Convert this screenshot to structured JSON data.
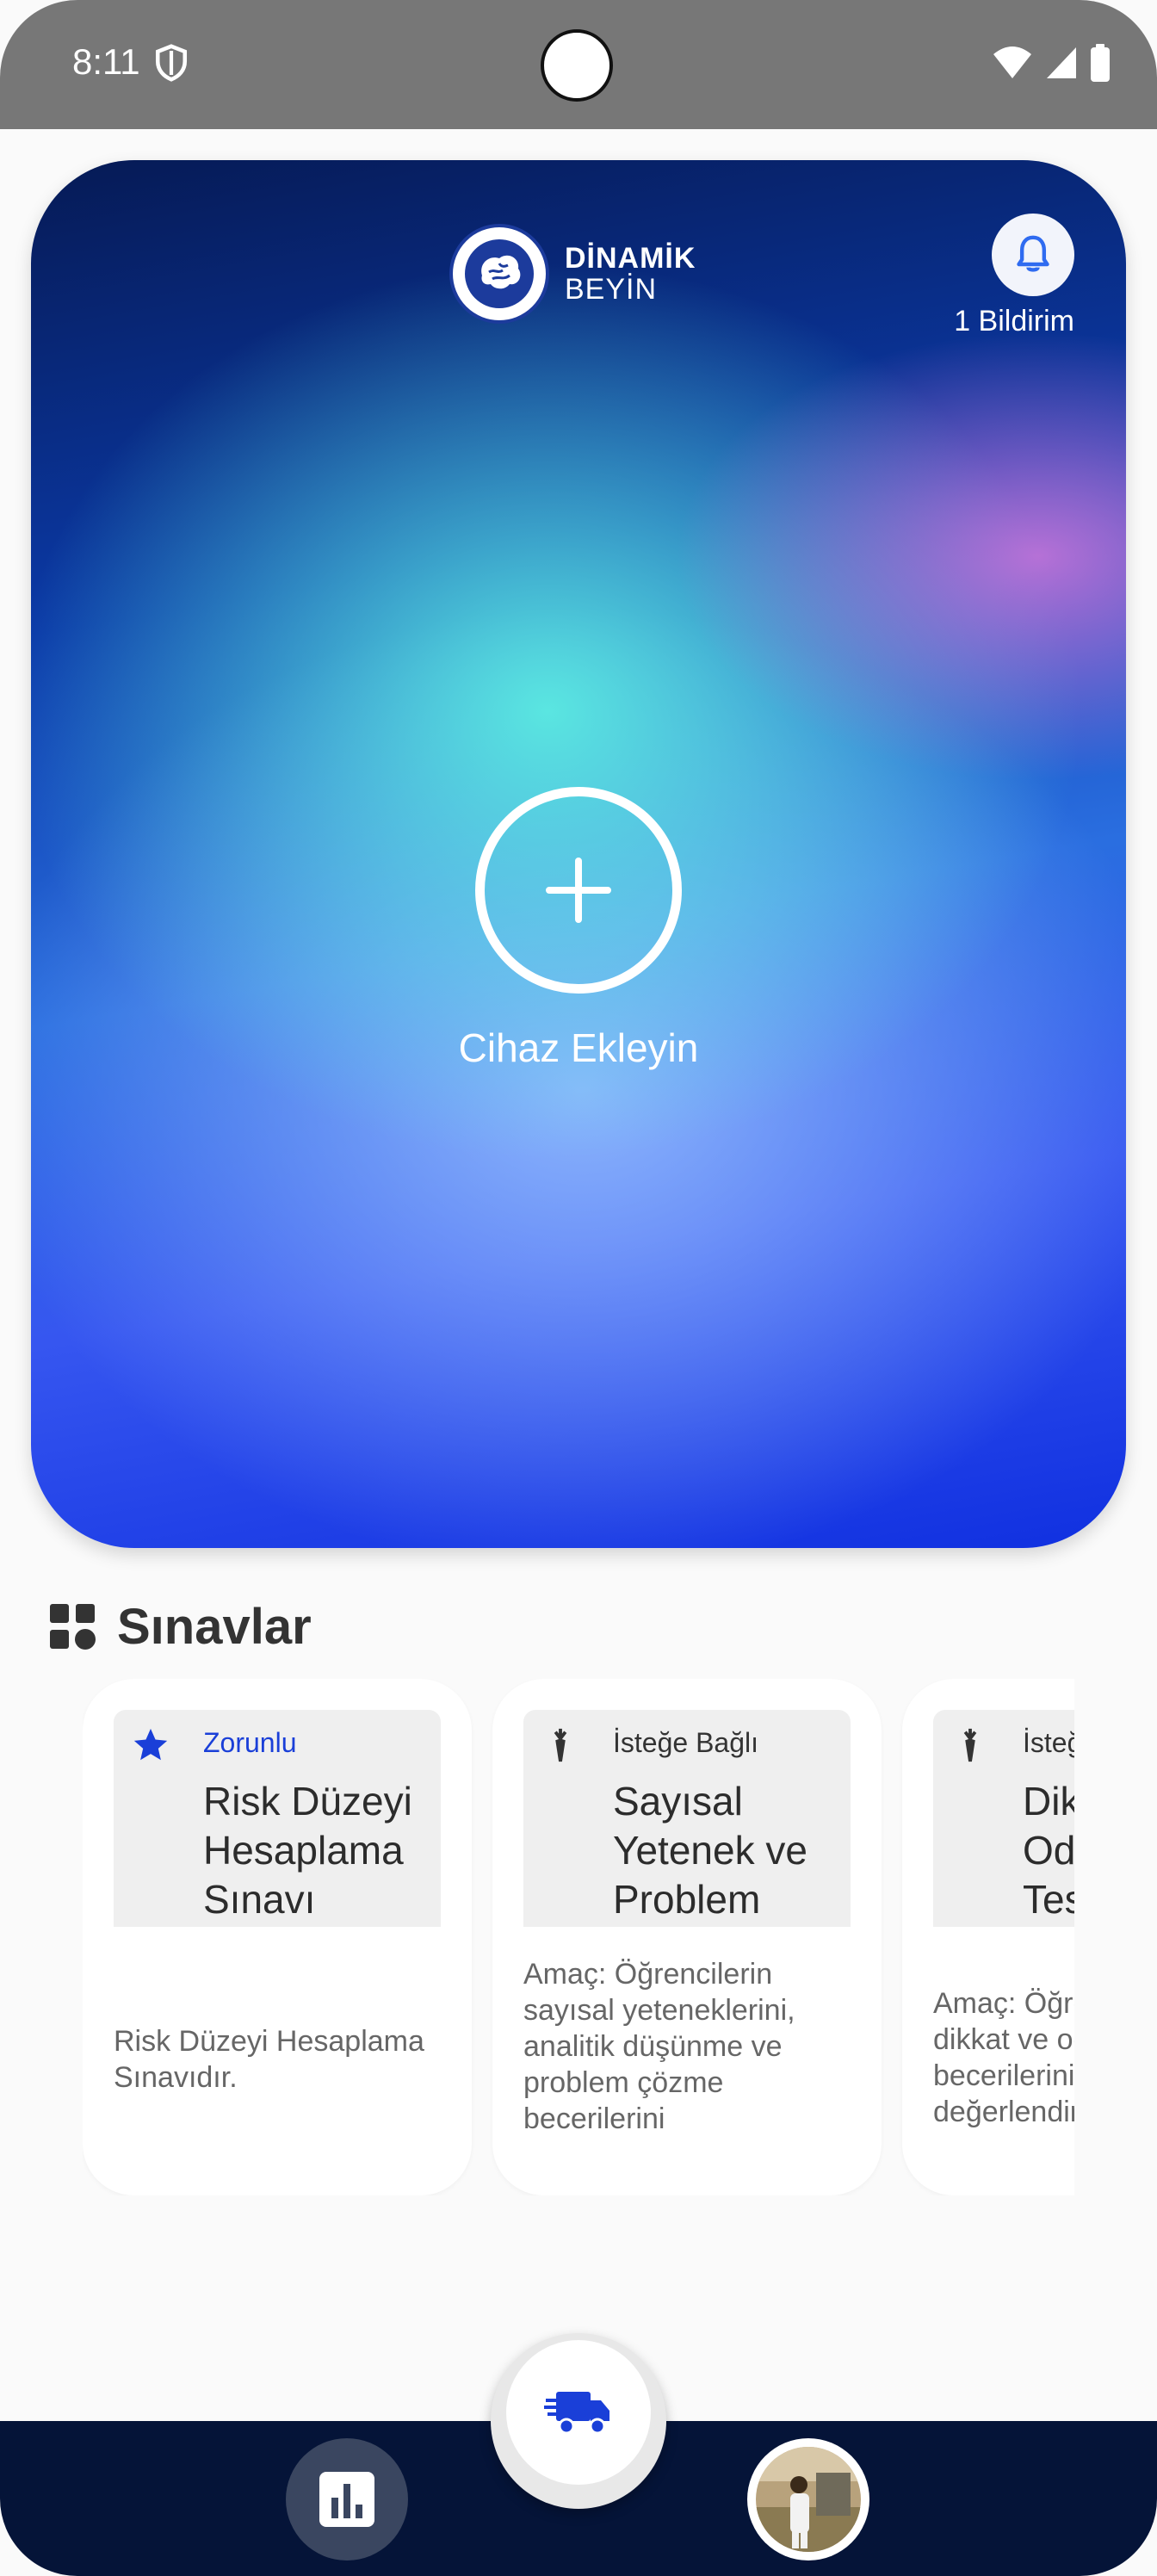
{
  "status_bar": {
    "time": "8:11"
  },
  "brand": {
    "line1": "DİNAMİK",
    "line2": "BEYİN"
  },
  "notifications": {
    "label": "1 Bildirim"
  },
  "device": {
    "add_label": "Cihaz Ekleyin"
  },
  "exams": {
    "title": "Sınavlar",
    "cards": [
      {
        "tag": "Zorunlu",
        "title": "Risk Düzeyi Hesaplama Sınavı",
        "description": "Risk Düzeyi Hesaplama Sınavıdır."
      },
      {
        "tag": "İsteğe Bağlı",
        "title": "Sayısal Yetenek ve Problem",
        "description": "Amaç: Öğrencilerin sayısal yeteneklerini, analitik düşünme ve problem çözme becerilerini değerlendirmek."
      },
      {
        "tag": "İsteğe Bağlı",
        "title": "Dikkat Odaklanma Testi",
        "description": "Amaç: Öğrencilerin dikkat ve odaklanma becerilerini değerlendirmek."
      }
    ]
  },
  "colors": {
    "accent": "#1a3fd8",
    "nav_background": "#051438",
    "status_bar": "#777777"
  },
  "icons": {
    "status": [
      "shield-icon",
      "wifi-icon",
      "signal-icon",
      "battery-icon"
    ],
    "header": [
      "brain-logo-icon",
      "bell-icon"
    ],
    "section": "dashboard-grid-icon",
    "card_tags": [
      "star-icon",
      "carrot-icon",
      "carrot-icon"
    ],
    "nav": [
      "bar-chart-icon",
      "truck-icon",
      "profile-avatar"
    ]
  }
}
